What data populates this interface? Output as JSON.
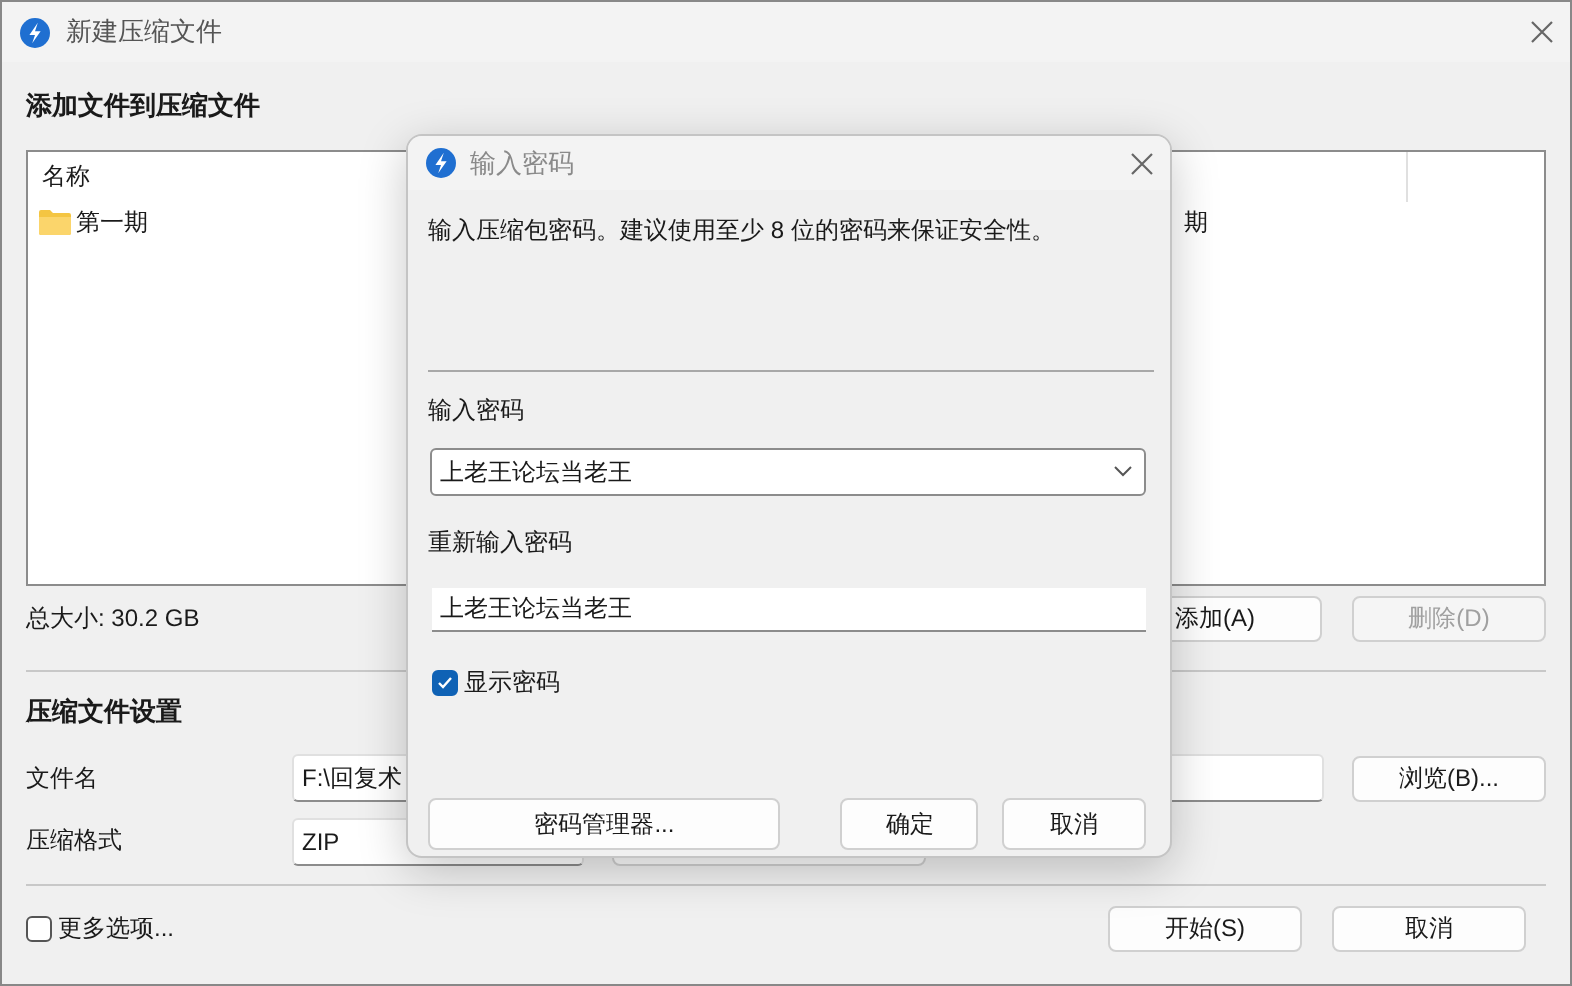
{
  "window": {
    "title": "新建压缩文件"
  },
  "add_section": {
    "heading": "添加文件到压缩文件",
    "list": {
      "columns": [
        "名称"
      ],
      "rows": [
        {
          "name": "第一期",
          "column_2": "期"
        }
      ]
    },
    "total_size": "总大小: 30.2 GB",
    "buttons": [
      {
        "label": "添加(A)",
        "disabled": false
      },
      {
        "label": "删除(D)",
        "disabled": true
      }
    ]
  },
  "settings": {
    "heading": "压缩文件设置",
    "filename": {
      "label": "文件名",
      "value": "F:\\回复术"
    },
    "browse_button": "浏览(B)...",
    "format": {
      "label": "压缩格式",
      "value": "ZIP"
    }
  },
  "more_options": {
    "label": "更多选项...",
    "checked": false
  },
  "footer_buttons": [
    "开始(S)",
    "取消"
  ],
  "dialog": {
    "title": "输入密码",
    "description": "输入压缩包密码。建议使用至少 8 位的密码来保证安全性。",
    "password": {
      "label": "输入密码",
      "value": "上老王论坛当老王"
    },
    "confirm": {
      "label": "重新输入密码",
      "value": "上老王论坛当老王"
    },
    "show_password": {
      "label": "显示密码",
      "checked": true
    },
    "buttons": [
      "密码管理器...",
      "确定",
      "取消"
    ]
  }
}
